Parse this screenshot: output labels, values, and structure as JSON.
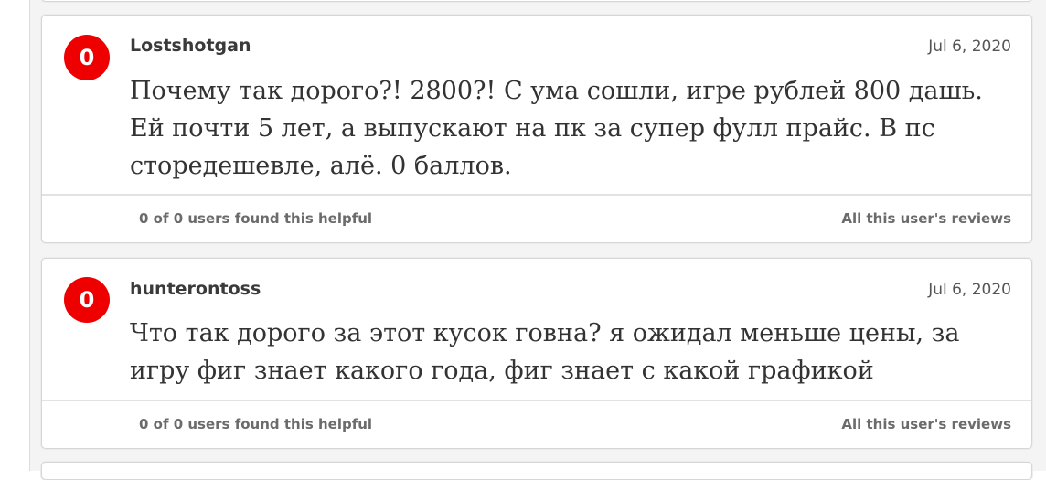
{
  "reviews": [
    {
      "score": "0",
      "username": "Lostshotgan",
      "date": "Jul 6, 2020",
      "text": "Почему так дорого?! 2800?! С ума сошли, игре рублей 800 дашь. Ей почти 5 лет, а выпускают на пк за супер фулл прайс. В пс сторедешевле, алё. 0 баллов.",
      "helpful": "0 of 0 users found this helpful",
      "all_reviews_link": "All this user's reviews"
    },
    {
      "score": "0",
      "username": "hunterontoss",
      "date": "Jul 6, 2020",
      "text": "Что так дорого за этот кусок говна? я ожидал меньше цены, за игру фиг знает какого года, фиг знает с какой графикой",
      "helpful": "0 of 0 users found this helpful",
      "all_reviews_link": "All this user's reviews"
    }
  ],
  "colors": {
    "score_negative": "#ee0000",
    "text": "#333333",
    "muted": "#6b6b6b"
  }
}
